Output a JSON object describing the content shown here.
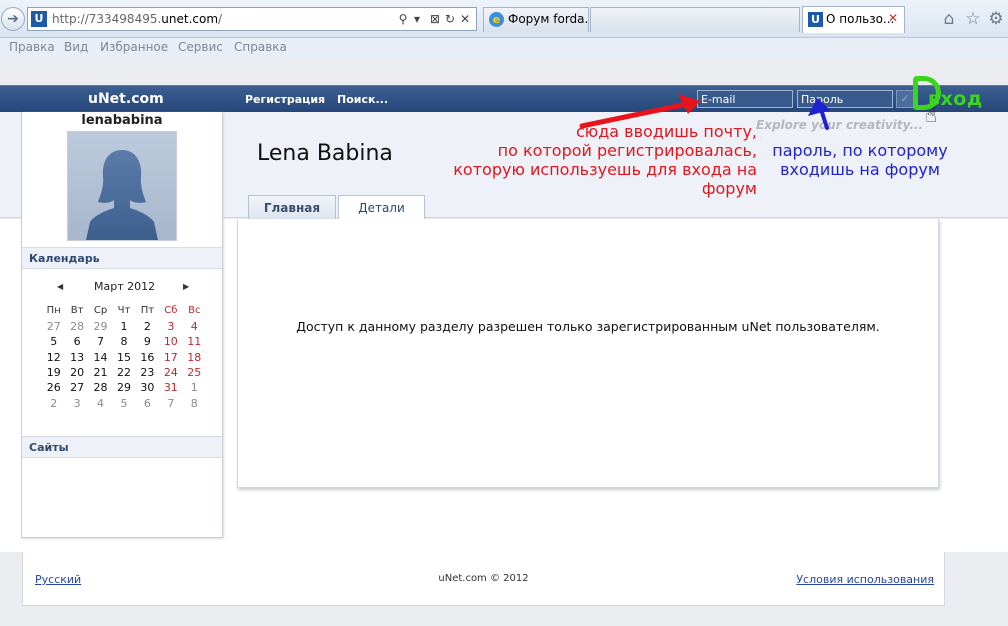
{
  "browser": {
    "address_host": "http://733498495.",
    "address_domain": "unet.com",
    "address_path": "/",
    "tabs": [
      {
        "label": "Форум forda..."
      },
      {
        "label": ""
      },
      {
        "label": "О пользо..."
      }
    ],
    "menu": [
      "Правка",
      "Вид",
      "Избранное",
      "Сервис",
      "Справка"
    ]
  },
  "site": {
    "logo": "uNet.com",
    "nav": [
      "Регистрация",
      "Поиск..."
    ],
    "login": {
      "email_placeholder": "E-mail",
      "password_placeholder": "Пароль",
      "submit_label": "✓"
    },
    "tagline": "Explore your creativity..."
  },
  "profile": {
    "username": "lenababina",
    "full_name": "Lena Babina",
    "tabs": [
      "Главная",
      "Детали"
    ],
    "active_tab": "Детали"
  },
  "sidebar": {
    "calendar_title": "Календарь",
    "month": "Март 2012",
    "weekdays": [
      "Пн",
      "Вт",
      "Ср",
      "Чт",
      "Пт",
      "Сб",
      "Вс"
    ],
    "weeks": [
      [
        "27",
        "28",
        "29",
        "1",
        "2",
        "3",
        "4"
      ],
      [
        "5",
        "6",
        "7",
        "8",
        "9",
        "10",
        "11"
      ],
      [
        "12",
        "13",
        "14",
        "15",
        "16",
        "17",
        "18"
      ],
      [
        "19",
        "20",
        "21",
        "22",
        "23",
        "24",
        "25"
      ],
      [
        "26",
        "27",
        "28",
        "29",
        "30",
        "31",
        "1"
      ],
      [
        "2",
        "3",
        "4",
        "5",
        "6",
        "7",
        "8"
      ]
    ],
    "sites_title": "Сайты"
  },
  "content": {
    "message": "Доступ к данному разделу разрешен только зарегистрированным uNet пользователям."
  },
  "footer": {
    "language": "Русский",
    "copyright": "uNet.com © 2012",
    "terms": "Условия использования"
  },
  "annotations": {
    "email_note": "сюда вводишь почту,\nпо которой регистрировалась,\nкоторую используешь для входа на форум",
    "password_note": "пароль, по которому\nвходишь на форум",
    "login_label": "вход",
    "email_color": "#e8141c",
    "password_color": "#2121d4",
    "login_color": "#3cd51d"
  }
}
